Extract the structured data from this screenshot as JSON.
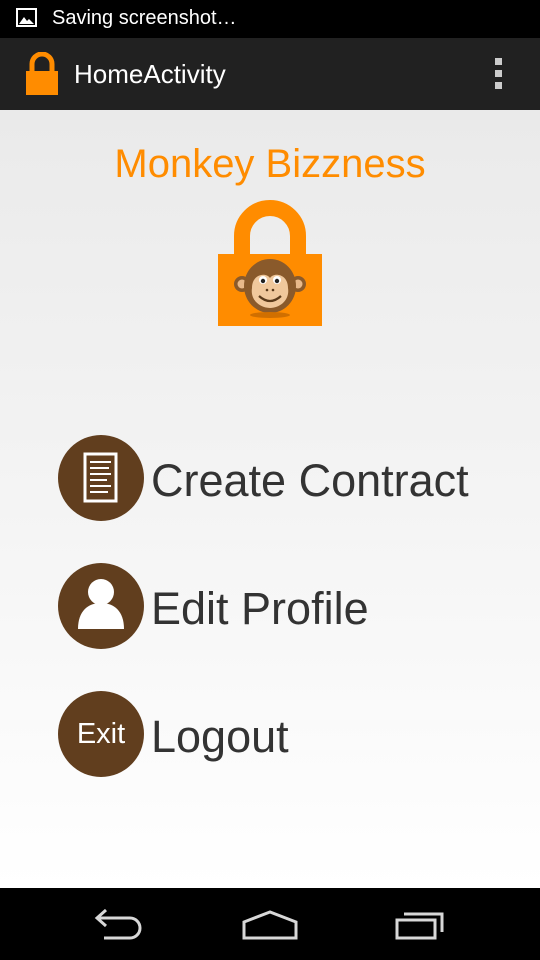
{
  "status_bar": {
    "notification_icon": "image-icon",
    "text": "Saving screenshot…"
  },
  "action_bar": {
    "app_icon": "lock-icon",
    "title": "HomeActivity",
    "overflow_icon": "overflow-menu-icon"
  },
  "header": {
    "brand_title": "Monkey Bizzness",
    "logo": "monkey-lock-logo"
  },
  "menu": {
    "items": [
      {
        "icon": "contract-document-icon",
        "label": "Create Contract"
      },
      {
        "icon": "profile-person-icon",
        "label": "Edit Profile"
      },
      {
        "icon": "exit-icon",
        "icon_text": "Exit",
        "label": "Logout"
      }
    ]
  },
  "nav_bar": {
    "back_icon": "back-icon",
    "home_icon": "home-icon",
    "recents_icon": "recent-apps-icon"
  },
  "colors": {
    "accent": "#ff8c00",
    "menu_circle": "#613e1e",
    "action_bar": "#212121",
    "label_text": "#333333"
  }
}
